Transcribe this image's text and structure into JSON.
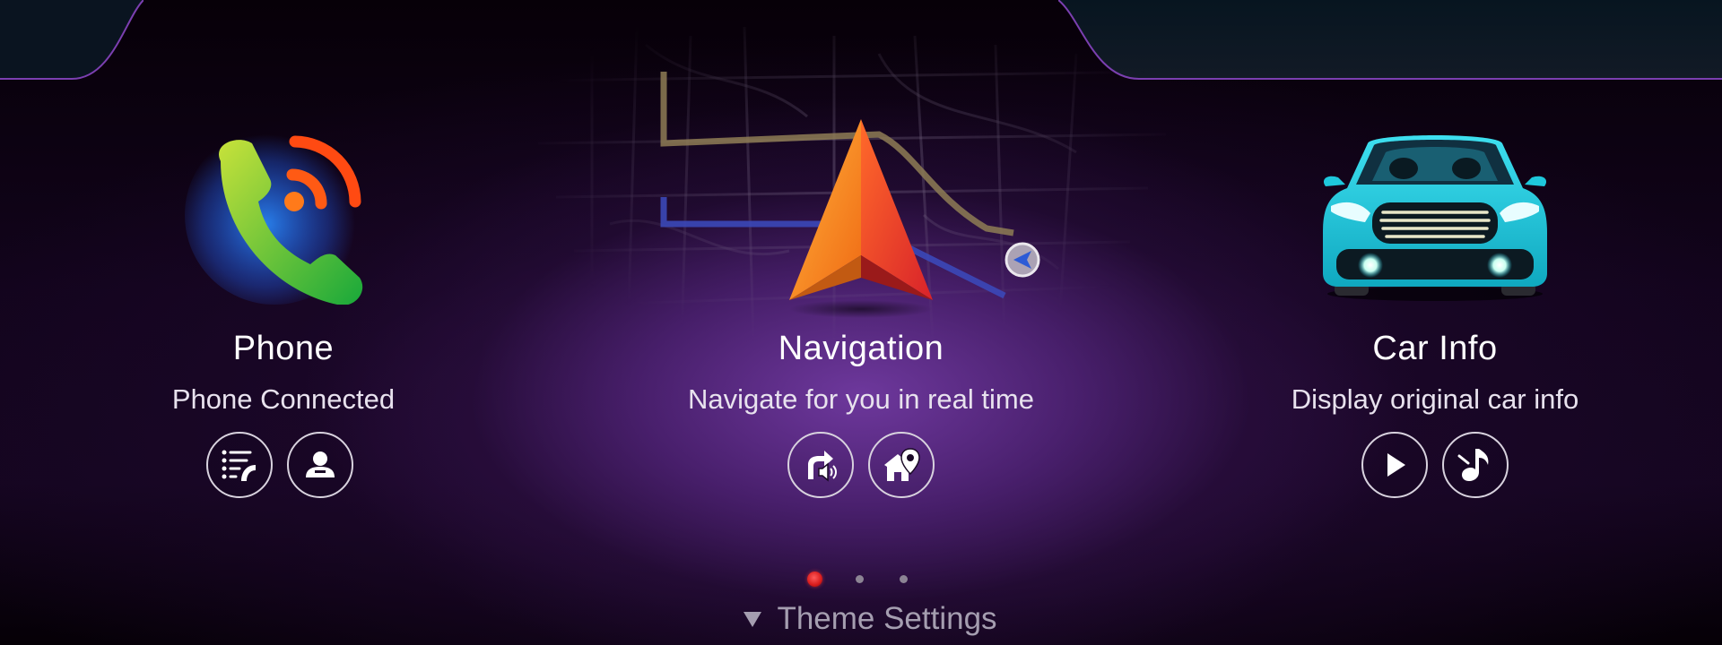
{
  "panels": {
    "phone": {
      "title": "Phone",
      "subtitle": "Phone Connected",
      "icon": "phone-wifi-icon",
      "buttons": [
        {
          "name": "call-log-button",
          "icon": "call-log-icon"
        },
        {
          "name": "contacts-button",
          "icon": "contact-icon"
        }
      ]
    },
    "navigation": {
      "title": "Navigation",
      "subtitle": "Navigate for you in real time",
      "icon": "navigation-arrow-icon",
      "buttons": [
        {
          "name": "nav-voice-button",
          "icon": "turn-voice-icon"
        },
        {
          "name": "nav-home-button",
          "icon": "home-location-icon"
        }
      ]
    },
    "car": {
      "title": "Car Info",
      "subtitle": "Display original car info",
      "icon": "car-icon",
      "buttons": [
        {
          "name": "play-button",
          "icon": "play-icon"
        },
        {
          "name": "music-button",
          "icon": "music-note-icon"
        }
      ]
    }
  },
  "pager": {
    "count": 3,
    "active": 0
  },
  "theme_settings": {
    "label": "Theme Settings",
    "icon": "triangle-down-icon"
  },
  "colors": {
    "accent_purple": "#6a2f9a",
    "dot_active": "#e02020",
    "car_body": "#1ec8dc",
    "nav_arrow": "#ff7a1a",
    "phone_green": "#37c23a",
    "phone_waves": "#ff4a12"
  }
}
